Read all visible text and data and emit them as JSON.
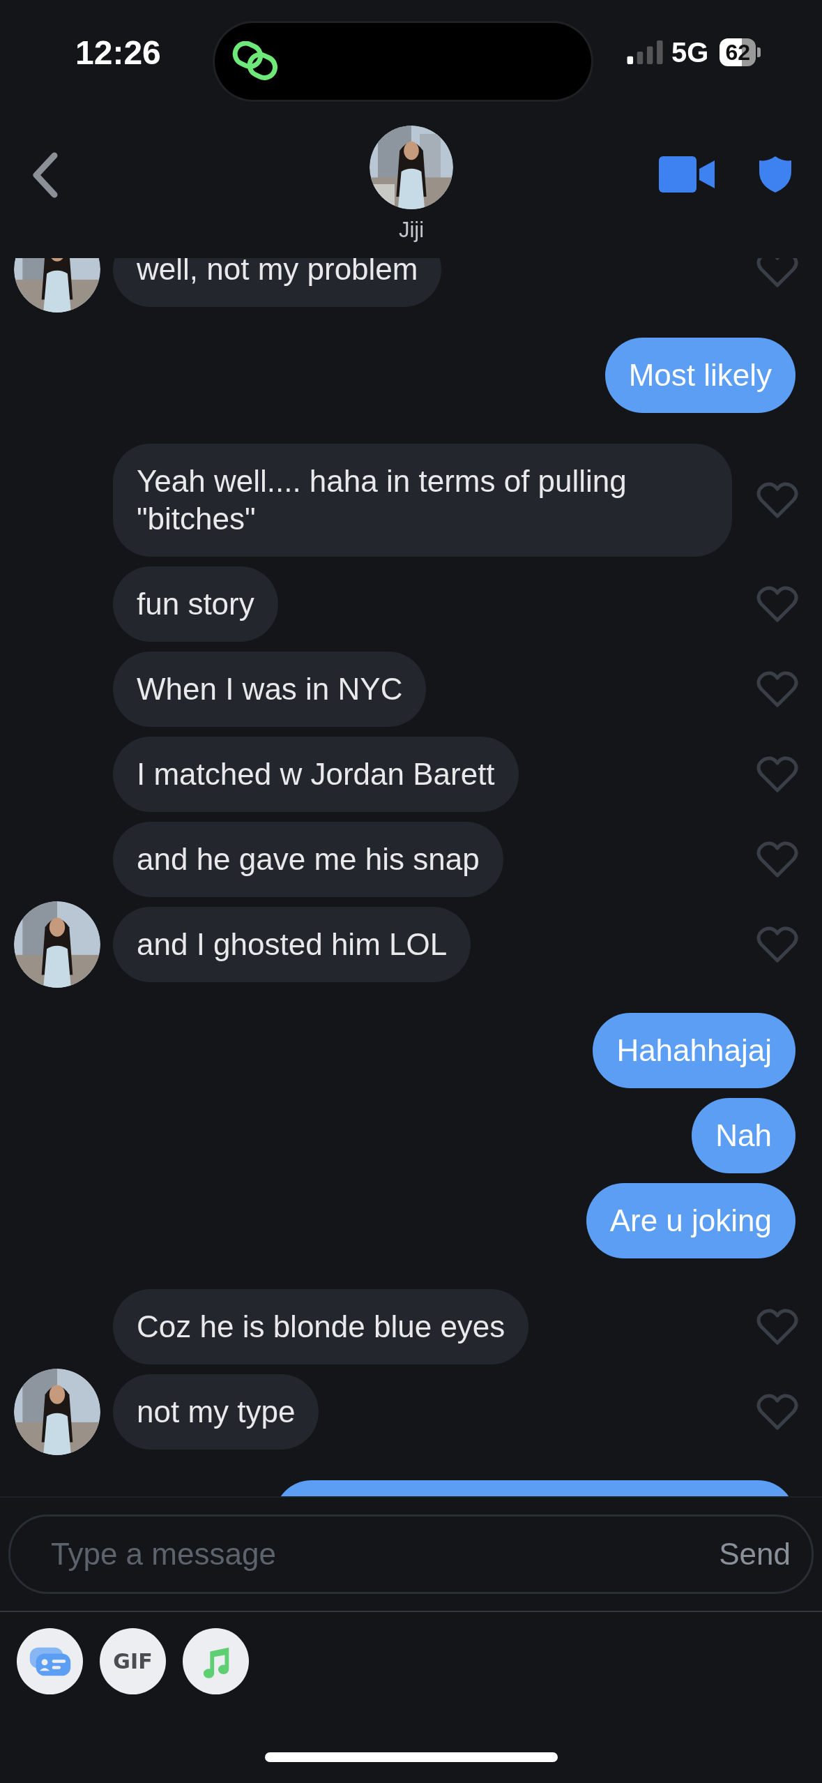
{
  "status_bar": {
    "time": "12:26",
    "network": "5G",
    "battery": "62"
  },
  "header": {
    "contact_name": "Jiji"
  },
  "groups": [
    {
      "kind": "incoming",
      "messages": [
        {
          "text": "well, not my problem",
          "liked": false
        }
      ]
    },
    {
      "kind": "outgoing",
      "messages": [
        {
          "text": "Most likely"
        }
      ]
    },
    {
      "kind": "incoming",
      "messages": [
        {
          "text": "Yeah well.... haha in terms of pulling \"bitches\"",
          "liked": false
        },
        {
          "text": "fun story",
          "liked": false
        },
        {
          "text": "When I was in NYC",
          "liked": false
        },
        {
          "text": "I matched w Jordan Barett",
          "liked": false
        },
        {
          "text": "and he gave me his snap",
          "liked": false
        },
        {
          "text": "and I ghosted him LOL",
          "liked": false
        }
      ]
    },
    {
      "kind": "outgoing",
      "messages": [
        {
          "text": "Hahahhajaj"
        },
        {
          "text": "Nah"
        },
        {
          "text": "Are u joking"
        }
      ]
    },
    {
      "kind": "incoming",
      "messages": [
        {
          "text": "Coz he is blonde blue eyes",
          "liked": false
        },
        {
          "text": "not my type",
          "liked": false
        }
      ]
    }
  ],
  "more_below": true,
  "composer": {
    "placeholder": "Type a message",
    "send": "Send"
  },
  "toolbar": [
    {
      "kind": "card"
    },
    {
      "kind": "gif",
      "label": "GIF"
    },
    {
      "kind": "music"
    }
  ]
}
